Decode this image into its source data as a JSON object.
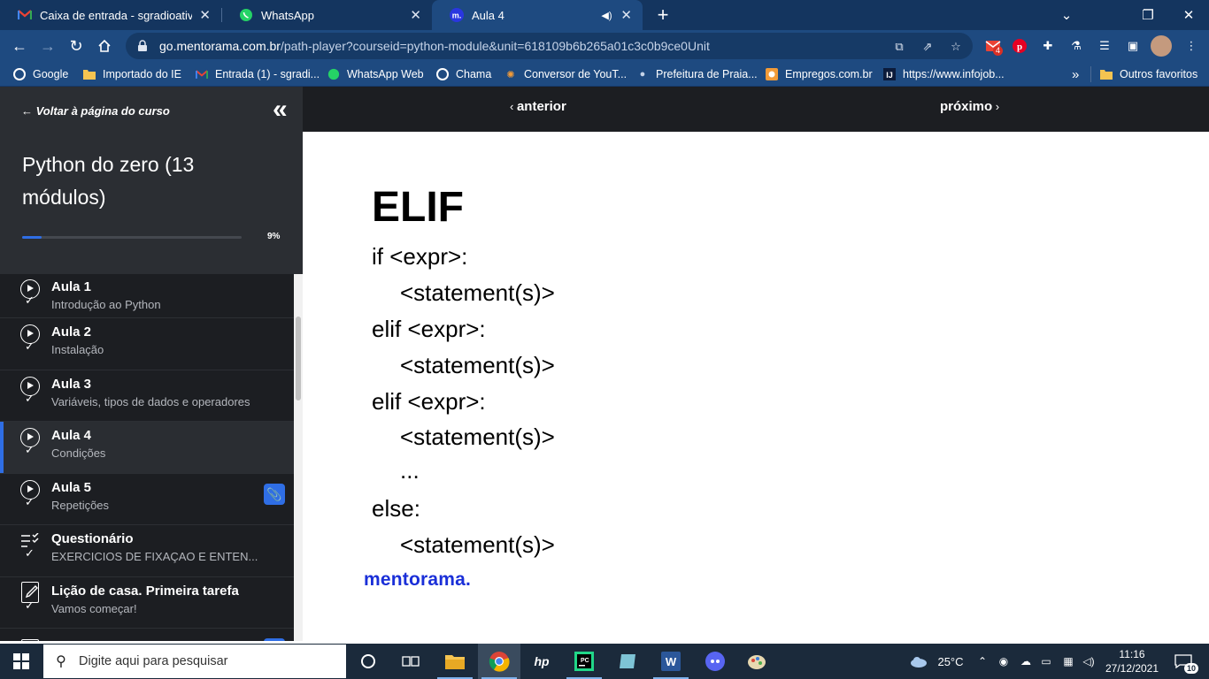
{
  "browser": {
    "tabs": [
      {
        "title": "Caixa de entrada - sgradioativo@",
        "icon": "gmail-icon",
        "active": false
      },
      {
        "title": "WhatsApp",
        "icon": "whatsapp-icon",
        "active": false
      },
      {
        "title": "Aula 4",
        "icon": "mentorama-icon",
        "active": true
      }
    ],
    "url_host": "go.mentorama.com.br",
    "url_path": "/path-player?courseid=python-module&unit=618109b6b265a01c3c0b9ce0Unit",
    "gmail_badge": "4",
    "bookmarks": [
      {
        "label": "Google",
        "icon": "google-icon"
      },
      {
        "label": "Importado do IE",
        "icon": "folder-icon"
      },
      {
        "label": "Entrada (1) - sgradi...",
        "icon": "gmail-icon"
      },
      {
        "label": "WhatsApp Web",
        "icon": "whatsapp-icon"
      },
      {
        "label": "Chama",
        "icon": "google-icon"
      },
      {
        "label": "Conversor de YouT...",
        "icon": "converter-icon"
      },
      {
        "label": "Prefeitura de Praia...",
        "icon": "pin-icon"
      },
      {
        "label": "Empregos.com.br",
        "icon": "empregos-icon"
      },
      {
        "label": "https://www.infojob...",
        "icon": "infojobs-icon"
      }
    ],
    "more_bookmarks": "»",
    "other_favorites": "Outros favoritos"
  },
  "sidebar": {
    "back_label": "← Voltar à página do curso",
    "course_title": "Python do zero (13 módulos)",
    "progress_percent": 9,
    "progress_label": "9%",
    "lessons": [
      {
        "title": "Aula 1",
        "subtitle": "Introdução ao Python",
        "type": "video",
        "done": true,
        "active": false
      },
      {
        "title": "Aula 2",
        "subtitle": "Instalação",
        "type": "video",
        "done": true,
        "active": false
      },
      {
        "title": "Aula 3",
        "subtitle": "Variáveis, tipos de dados e operadores",
        "type": "video",
        "done": true,
        "active": false
      },
      {
        "title": "Aula 4",
        "subtitle": "Condições",
        "type": "video",
        "done": true,
        "active": true
      },
      {
        "title": "Aula 5",
        "subtitle": "Repetições",
        "type": "video",
        "done": true,
        "active": false,
        "attachment": true
      },
      {
        "title": "Questionário",
        "subtitle": "EXERCICIOS DE FIXAÇAO E ENTEN...",
        "type": "quiz",
        "done": true,
        "active": false
      },
      {
        "title": "Lição de casa. Primeira tarefa",
        "subtitle": "Vamos começar!",
        "type": "homework",
        "done": true,
        "active": false
      }
    ]
  },
  "content": {
    "prev_label": "anterior",
    "next_label": "próximo",
    "slide_title": "ELIF",
    "code_lines": [
      "if <expr>:",
      "<statement(s)>",
      "elif <expr>:",
      "<statement(s)>",
      "elif <expr>:",
      "<statement(s)>",
      "...",
      "else:",
      "<statement(s)>"
    ],
    "brand": "mentorama."
  },
  "taskbar": {
    "search_placeholder": "Digite aqui para pesquisar",
    "temperature": "25°C",
    "time": "11:16",
    "date": "27/12/2021",
    "notification_count": "10"
  },
  "colors": {
    "accent": "#2f6ee5",
    "brand_blue": "#1a2fd8",
    "tab_bar": "#14355f",
    "toolbar": "#1e4a80"
  }
}
